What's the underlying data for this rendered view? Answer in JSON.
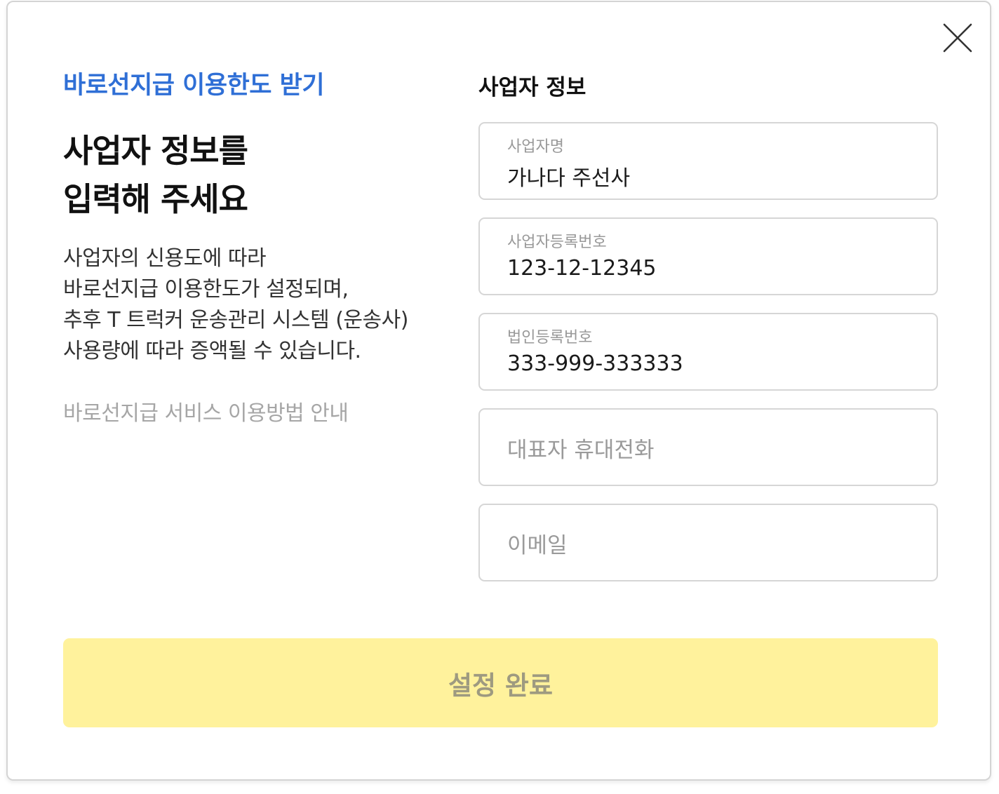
{
  "eyebrow": "바로선지급 이용한도 받기",
  "headline": [
    "사업자 정보를",
    "입력해 주세요"
  ],
  "description": [
    "사업자의 신용도에 따라",
    "바로선지급 이용한도가 설정되며,",
    "추후 T 트럭커 운송관리 시스템 (운송사)",
    "사용량에 따라 증액될 수 있습니다."
  ],
  "guide_link": "바로선지급 서비스 이용방법 안내",
  "form": {
    "section_title": "사업자 정보",
    "fields": [
      {
        "label": "사업자명",
        "value": "가나다 주선사"
      },
      {
        "label": "사업자등록번호",
        "value": "123-12-12345"
      },
      {
        "label": "법인등록번호",
        "value": "333-999-333333"
      },
      {
        "placeholder": "대표자 휴대전화"
      },
      {
        "placeholder": "이메일"
      }
    ]
  },
  "submit_label": "설정 완료",
  "colors": {
    "accent_blue": "#2f6fd6",
    "button_yellow": "#fff29c",
    "button_text": "#9e9a80",
    "border": "#d6d6d6"
  },
  "icons": {
    "close": "close-icon"
  }
}
